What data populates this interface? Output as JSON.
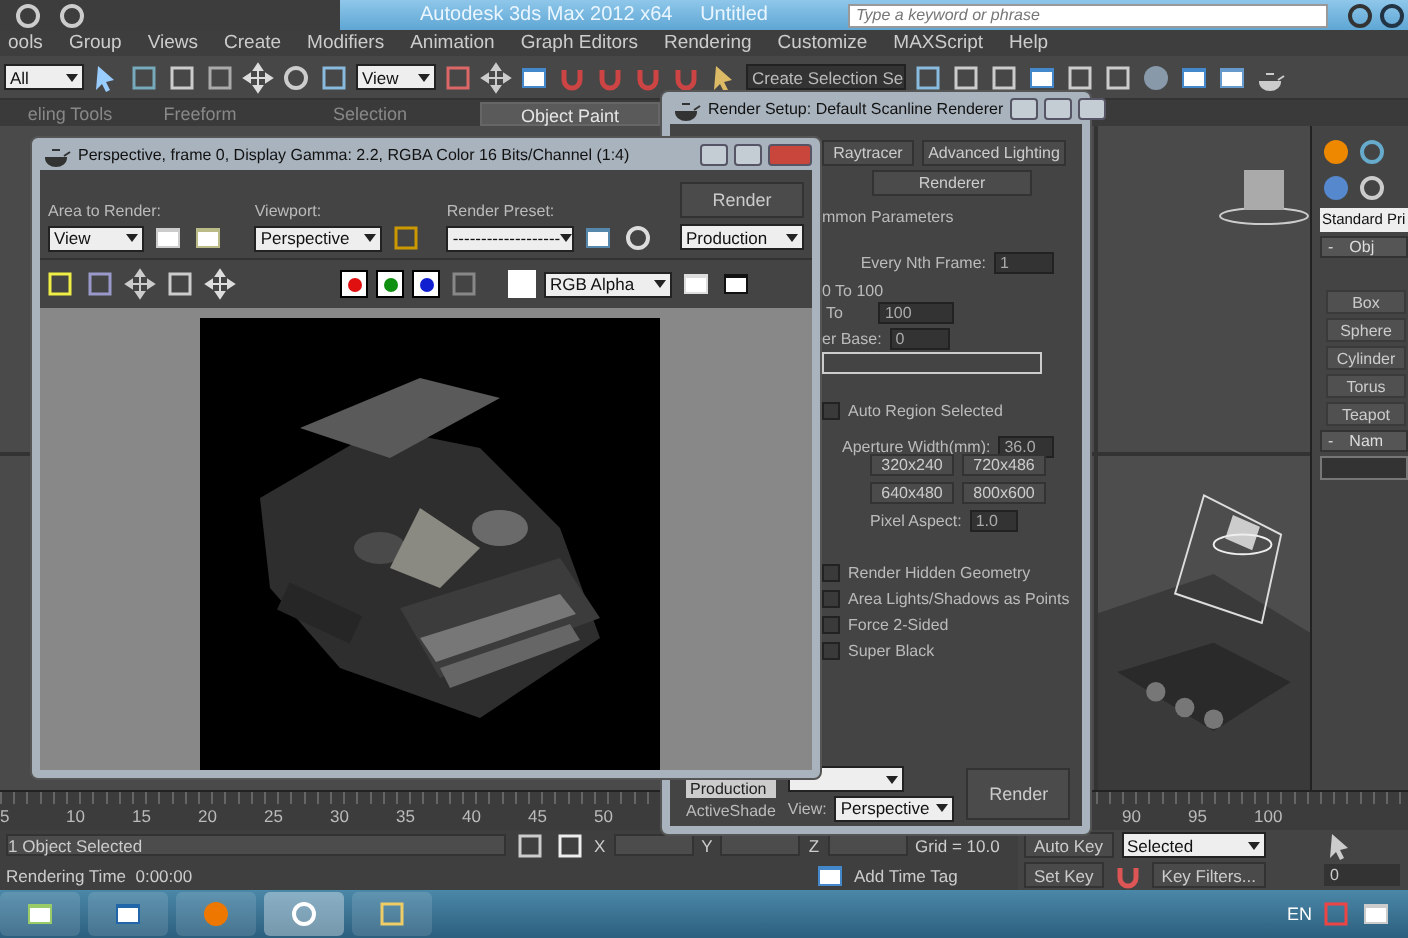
{
  "app_window": {
    "title": "Autodesk 3ds Max 2012 x64",
    "document": "Untitled",
    "search": {
      "placeholder": "Type a keyword or phrase"
    }
  },
  "menu": [
    "ools",
    "Group",
    "Views",
    "Create",
    "Modifiers",
    "Animation",
    "Graph Editors",
    "Rendering",
    "Customize",
    "MAXScript",
    "Help"
  ],
  "toolbar": {
    "selection_filter": "All",
    "reference_coord": "View",
    "named_selection": "Create Selection Se"
  },
  "ribbon_tabs": [
    {
      "label": "eling Tools",
      "selected": false
    },
    {
      "label": "Freeform",
      "selected": false
    },
    {
      "label": "Selection",
      "selected": false
    },
    {
      "label": "Object Paint",
      "selected": true
    }
  ],
  "command_panel": {
    "category": "Standard Pri",
    "rollout": {
      "sign": "-",
      "label": "Obj"
    },
    "buttons": [
      "Box",
      "Sphere",
      "Cylinder",
      "Torus",
      "Teapot"
    ],
    "name_rollout": {
      "sign": "-",
      "label": "Nam"
    }
  },
  "render_setup": {
    "title": "Render Setup: Default Scanline Renderer",
    "tabs": [
      {
        "label": "Raytracer",
        "selected": false
      },
      {
        "label": "Advanced Lighting",
        "selected": false
      },
      {
        "label": "Renderer",
        "selected": false
      }
    ],
    "rollout": "mmon Parameters",
    "every_nth_label": "Every Nth Frame:",
    "every_nth_value": "1",
    "range_text": "0 To 100",
    "to_label": "To",
    "to_value": "100",
    "file_base_label": "er Base:",
    "file_base_value": "0",
    "auto_region": {
      "label": "Auto Region Selected",
      "checked": false
    },
    "aperture_label": "Aperture Width(mm):",
    "aperture_value": "36.0",
    "presets": [
      "320x240",
      "720x486",
      "640x480",
      "800x600"
    ],
    "pixel_aspect_label": "Pixel Aspect:",
    "pixel_aspect_value": "1.0",
    "options": [
      {
        "label": "Render Hidden Geometry",
        "checked": false
      },
      {
        "label": "Area Lights/Shadows as Points",
        "checked": false
      },
      {
        "label": "Force 2-Sided",
        "checked": false
      },
      {
        "label": "Super Black",
        "checked": false
      }
    ],
    "production": "Production",
    "activeshade": "ActiveShade",
    "view_label": "View:",
    "view_value": "Perspective",
    "render_button": "Render"
  },
  "frame_window": {
    "title": "Perspective, frame 0, Display Gamma: 2.2, RGBA Color 16 Bits/Channel (1:4)",
    "area_label": "Area to Render:",
    "area_value": "View",
    "viewport_label": "Viewport:",
    "viewport_value": "Perspective",
    "preset_label": "Render Preset:",
    "preset_value": "-------------------",
    "render_button": "Render",
    "render_mode": "Production",
    "channels": [
      {
        "color": "#e01010",
        "on": true
      },
      {
        "color": "#109010",
        "on": true
      },
      {
        "color": "#1020d0",
        "on": true
      }
    ],
    "display_channel": "RGB Alpha"
  },
  "timeline": {
    "ticks": [
      "5",
      "10",
      "15",
      "20",
      "25",
      "30",
      "35",
      "40",
      "45",
      "50",
      "90",
      "95",
      "100"
    ]
  },
  "status": {
    "selection": "1 Object Selected",
    "render_time": "Rendering Time  0:00:00",
    "x_label": "X",
    "y_label": "Y",
    "z_label": "Z",
    "grid": "Grid = 10.0",
    "add_time_tag": "Add Time Tag",
    "auto_key": "Auto Key",
    "key_mode": "Selected",
    "set_key": "Set Key",
    "key_filters": "Key Filters...",
    "frame": "0"
  },
  "taskbar": {
    "language": "EN"
  }
}
